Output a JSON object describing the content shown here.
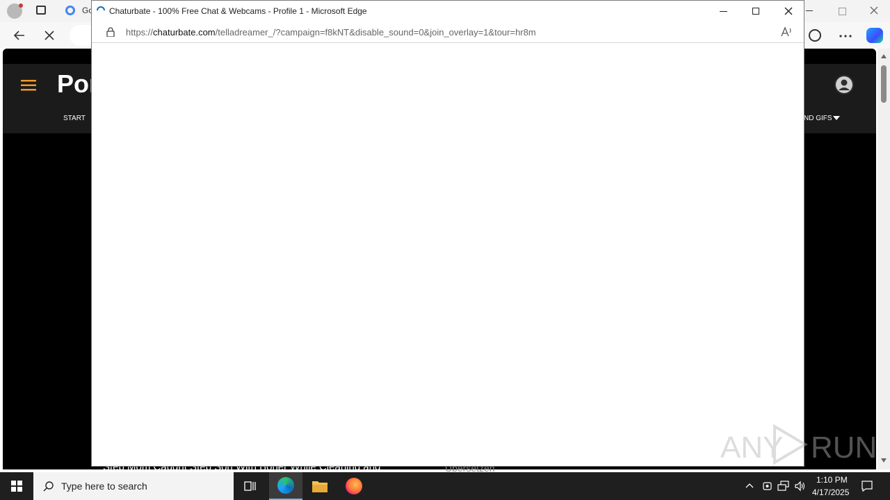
{
  "background_browser": {
    "tab_title": "Go",
    "nav_start": "START",
    "nav_gifs": "ND GIFS",
    "brand": "Por",
    "bottom_text": "Step Mom Caught Step Son With Boner While Cleaning and",
    "bottom_side": "Übersetzen"
  },
  "popup": {
    "title": "Chaturbate - 100% Free Chat & Webcams - Profile 1 - Microsoft Edge",
    "url_prefix": "https://",
    "url_domain": "chaturbate.com",
    "url_path": "/telladreamer_/?campaign=f8kNT&disable_sound=0&join_overlay=1&tour=hr8m"
  },
  "taskbar": {
    "search_placeholder": "Type here to search",
    "time": "1:10 PM",
    "date": "4/17/2025"
  },
  "watermark": {
    "text_left": "ANY",
    "text_right": "RUN"
  },
  "colors": {
    "accent_orange": "#f19a2a",
    "taskbar": "#1f1f1f",
    "edge_blue": "#0f6cbd"
  }
}
